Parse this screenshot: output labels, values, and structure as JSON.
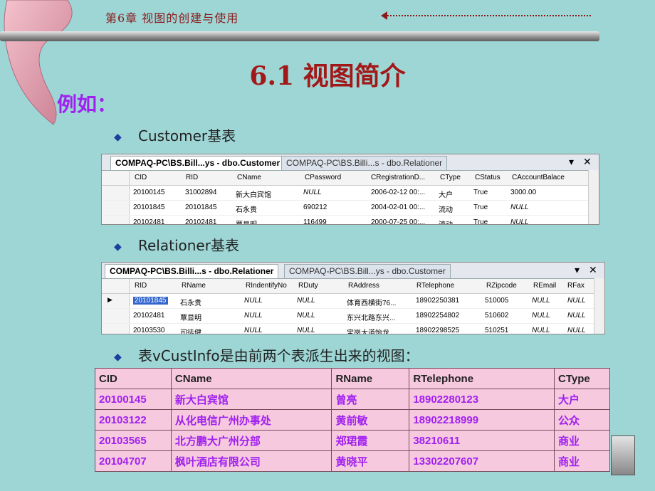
{
  "header": {
    "chapter": "第6章  视图的创建与使用"
  },
  "title": "6.1  视图简介",
  "example_label": "例如：",
  "bullets": {
    "customer": "Customer基表",
    "relationer": "Relationer基表",
    "view": "表vCustInfo是由前两个表派生出来的视图："
  },
  "grid1": {
    "tab_active": "COMPAQ-PC\\BS.Bill...ys - dbo.Customer",
    "tab_inactive": "COMPAQ-PC\\BS.Billi...s - dbo.Relationer",
    "columns": [
      "CID",
      "RID",
      "CName",
      "CPassword",
      "CRegistrationD...",
      "CType",
      "CStatus",
      "CAccountBalace"
    ],
    "rows": [
      [
        "20100145",
        "31002894",
        "新大白宾馆",
        "NULL",
        "2006-02-12 00:...",
        "大户",
        "True",
        "3000.00"
      ],
      [
        "20101845",
        "20101845",
        "石永贵",
        "690212",
        "2004-02-01 00:...",
        "流动",
        "True",
        "NULL"
      ],
      [
        "20102481",
        "20102481",
        "覃显明",
        "116499",
        "2000-07-25 00:...",
        "流动",
        "True",
        "NULL"
      ]
    ]
  },
  "grid2": {
    "tab_active": "COMPAQ-PC\\BS.Billi...s - dbo.Relationer",
    "tab_inactive": "COMPAQ-PC\\BS.Bill...ys - dbo.Customer",
    "columns": [
      "RID",
      "RName",
      "RIndentifyNo",
      "RDuty",
      "RAddress",
      "RTelephone",
      "RZipcode",
      "REmail",
      "RFax"
    ],
    "rows": [
      [
        "20101845",
        "石永贵",
        "NULL",
        "NULL",
        "体育西横街76...",
        "18902250381",
        "510005",
        "NULL",
        "NULL"
      ],
      [
        "20102481",
        "覃显明",
        "NULL",
        "NULL",
        "东兴北路东兴...",
        "18902254802",
        "510602",
        "NULL",
        "NULL"
      ],
      [
        "20103530",
        "司徒健",
        "NULL",
        "NULL",
        "宝岗大道怡龙...",
        "18902298525",
        "510251",
        "NULL",
        "NULL"
      ]
    ]
  },
  "view_table": {
    "headers": [
      "CID",
      "CName",
      "RName",
      "RTelephone",
      "CType"
    ],
    "rows": [
      [
        "20100145",
        "新大白宾馆",
        "曾亮",
        "18902280123",
        "大户"
      ],
      [
        "20103122",
        "从化电信广州办事处",
        "黄前敏",
        "18902218999",
        "公众"
      ],
      [
        "20103565",
        "北方鹏大广州分部",
        "郑珺霞",
        "38210611",
        "商业"
      ],
      [
        "20104707",
        "枫叶酒店有限公司",
        "黄晓平",
        "13302207607",
        "商业"
      ]
    ]
  }
}
